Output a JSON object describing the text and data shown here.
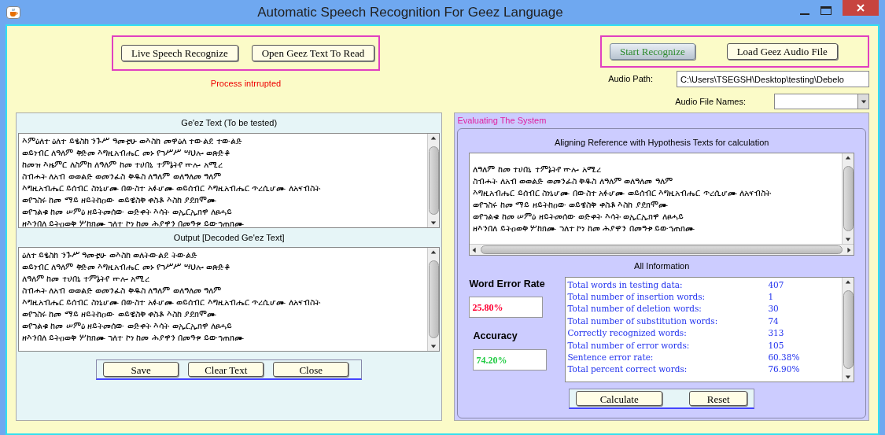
{
  "window": {
    "title": "Automatic Speech Recognition For Geez Language"
  },
  "top_left_buttons": [
    "Live Speech Recognize",
    "Open Geez Text To Read"
  ],
  "status_message": "Process intrrupted",
  "top_right_buttons": [
    {
      "label": "Start Recognize",
      "kind": "primary"
    },
    {
      "label": "Load Geez Audio File",
      "kind": "normal"
    }
  ],
  "audio_path": {
    "label": "Audio Path:",
    "value": "C:\\Users\\TSEGSH\\Desktop\\testing\\Debelo"
  },
  "audio_file_names": {
    "label": "Audio File Names:"
  },
  "geez_text": {
    "title": "Ge'ez Text (To be tested)",
    "lines": [
      "እምዕለተ ዕለተ ይፄስከ ንጉሥ ዓመቲሁ ወእስከ መዋዕለ ተውልደ ተውልድ",
      "ወይነብር ለዓለም ቅድመ እግዚአብሔር መኑ የኀሥሥ ሣህሎ ወጽድቆ",
      "ከመዝ እዜምር ለስምከ ለዓለም ከመ ተሀበኒ ተምኔትየ ኵሎ አሚረ",
      "ስብሐት ለአብ ወወልድ ወመንፈስ ቅዱስ ለዓለም ወለዓለመ ዓለም",
      "እግዚአብሔር ይሰብር ስነኒሆሙ በውስተ አፉሆሙ ወይሰብር እግዚአብሔር ጥረሲሆሙ ለአናብስት",
      "ወየኀስሩ ከመ ማይ ዘይትከዐው ወይዌስቅ ቀስቶ እስከ ያደክሞሙ",
      "ወየኀልቁ ከመ ሠምዕ ዘይትመሰው ወድቀት እሳት ወኢርኢክዋ ለፀሓይ",
      "ዘእንበለ ይትዐወቅ ሦከክሙ ኀለተ ኮነ ከመ ሕያዋን በመዓቱ ይውኅጠክሙ"
    ]
  },
  "output": {
    "title": "Output [Decoded Ge'ez Text]",
    "lines": [
      "ዕለተ ይፄስከ ንጉሥ ዓመቲሁ ወእስከ ወለትውልደ ትውልድ",
      "ወይነብር ለዓለም ቅድመ እግዚአብሔር መኑ የኀሥሥ ሣህሎ ወጽድቆ",
      "ለዓለም ከመ ተሀበኒ ተምኔትየ ኵሎ አሚረ",
      "ስብሐት ለአብ ወወልድ ወመንፈስ ቅዱስ ለዓለም ወለዓለመ ዓለም",
      "እግዚአብሔር ይሰብር ስነኒሆሙ በውስተ አፉሆሙ ወይሰብር እግዚአብሔር ጥረሲሆሙ ለአናብስት",
      "ወየኀስሩ ከመ ማይ ዘይትከዐው ወይዌስቅ ቀስቶ እስከ ያደክሞሙ",
      "ወየኀልቁ ከመ ሠምዕ ዘይትመሰው ወድቀት እሳት ወኢርኢክዋ ለፀሓይ",
      "ዘእንበለ ይትዐወቅ ሦከክሙ ኀለተ ኮነ ከመ ሕያዋን በመዓቱ ይውኅጠክሙ"
    ]
  },
  "left_buttons": [
    "Save",
    "Clear Text",
    "Close"
  ],
  "evaluation": {
    "title": "Evaluating The System",
    "alignment": {
      "title": "Aligning Reference with Hypothesis Texts for calculation",
      "lines": [
        "ለዓለም ከመ ተሀበኒ ተምኔትየ ኵሎ አሚረ",
        "ስብሐት ለአብ ወወልድ ወመንፈስ ቅዱስ ለዓለም ወለዓለመ ዓለም",
        "እግዚአብሔር ይሰብር ስነኒሆሙ በውስተ አፉሆሙ ወይሰብር እግዚአብሔር ጥረሲሆሙ ለአናብስት",
        "ወየኀስሩ ከመ ማይ ዘይትከዐው ወይዌስቅ ቀስቶ እስከ ያደክሞሙ",
        "ወየኀልቁ ከመ ሠምዕ ዘይትመሰው ወድቀት እሳት ወኢርኢክዋ ለፀሓይ",
        "ዘእንበለ ይትዐወቅ ሦከክሙ ኀለተ ኮነ ከመ ሕያዋን በመዓቱ ይውኅጠክሙ"
      ]
    },
    "all_information_title": "All Information",
    "metrics": [
      {
        "label": "Word Error Rate",
        "value": "25.80%",
        "color": "#ff0033"
      },
      {
        "label": "Accuracy",
        "value": "74.20%",
        "color": "#22cc44"
      }
    ],
    "statistics": [
      {
        "label": "Total words in testing data:",
        "value": "407"
      },
      {
        "label": "Total number of insertion words:",
        "value": "1"
      },
      {
        "label": "Total number of deletion words:",
        "value": "30"
      },
      {
        "label": "Total number of substitution words:",
        "value": "74"
      },
      {
        "label": "Correctly recognized words:",
        "value": "313"
      },
      {
        "label": "Total number of error words:",
        "value": "105"
      },
      {
        "label": "Sentence error rate:",
        "value": "60.38%"
      },
      {
        "label": "Total percent correct words:",
        "value": "76.90%"
      }
    ],
    "buttons": [
      "Calculate",
      "Reset"
    ]
  }
}
